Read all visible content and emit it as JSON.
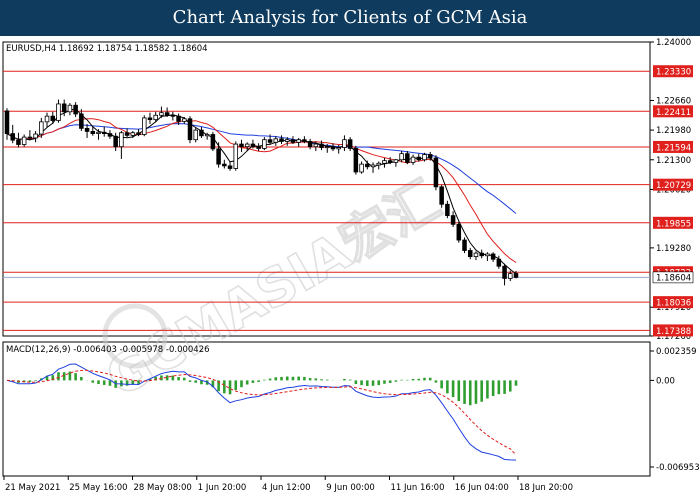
{
  "header": {
    "title": "Chart Analysis for Clients of GCM Asia"
  },
  "chart_data": {
    "type": "candlestick",
    "title": "EURUSD,H4 1.18692 1.18754 1.18582 1.18604",
    "symbol": "EURUSD",
    "timeframe": "H4",
    "ohlc_readout": {
      "open": 1.18692,
      "high": 1.18754,
      "low": 1.18582,
      "close": 1.18604
    },
    "current_price": 1.18604,
    "current_price_label": "1.18604",
    "price_axis": {
      "ylim": [
        1.1726,
        1.24
      ],
      "ticks": [
        {
          "value": 1.24,
          "label": "1.24000"
        },
        {
          "value": 1.2266,
          "label": "1.22660"
        },
        {
          "value": 1.2198,
          "label": "1.21980"
        },
        {
          "value": 1.213,
          "label": "1.21300"
        },
        {
          "value": 1.2062,
          "label": "1.20620"
        },
        {
          "value": 1.1928,
          "label": "1.19280"
        },
        {
          "value": 1.1792,
          "label": "1.17920"
        },
        {
          "value": 1.1726,
          "label": "1.17260"
        }
      ]
    },
    "levels": [
      {
        "value": 1.2333,
        "label": "1.23330"
      },
      {
        "value": 1.22411,
        "label": "1.22411"
      },
      {
        "value": 1.21594,
        "label": "1.21594"
      },
      {
        "value": 1.20729,
        "label": "1.20729"
      },
      {
        "value": 1.19855,
        "label": "1.19855"
      },
      {
        "value": 1.18722,
        "label": "1.18722"
      },
      {
        "value": 1.18036,
        "label": "1.18036"
      },
      {
        "value": 1.17388,
        "label": "1.17388"
      }
    ],
    "x_labels": [
      "21 May 2021",
      "25 May 16:00",
      "28 May 08:00",
      "1 Jun 20:00",
      "4 Jun 12:00",
      "9 Jun 00:00",
      "11 Jun 16:00",
      "16 Jun 04:00",
      "18 Jun 20:00"
    ],
    "candles": [
      [
        1.2242,
        1.2248,
        1.2176,
        1.219
      ],
      [
        1.219,
        1.221,
        1.2168,
        1.2175
      ],
      [
        1.2175,
        1.2192,
        1.2158,
        1.2165
      ],
      [
        1.2165,
        1.2188,
        1.216,
        1.2182
      ],
      [
        1.2182,
        1.2198,
        1.2175,
        1.218
      ],
      [
        1.218,
        1.2196,
        1.217,
        1.2189
      ],
      [
        1.2189,
        1.2226,
        1.218,
        1.2217
      ],
      [
        1.2217,
        1.2238,
        1.2205,
        1.223
      ],
      [
        1.223,
        1.224,
        1.2212,
        1.222
      ],
      [
        1.222,
        1.2268,
        1.2215,
        1.2258
      ],
      [
        1.2258,
        1.2268,
        1.223,
        1.224
      ],
      [
        1.224,
        1.226,
        1.2232,
        1.2255
      ],
      [
        1.2255,
        1.2262,
        1.2228,
        1.2235
      ],
      [
        1.2235,
        1.2246,
        1.2196,
        1.2202
      ],
      [
        1.2202,
        1.2212,
        1.218,
        1.2195
      ],
      [
        1.2195,
        1.2208,
        1.2185,
        1.219
      ],
      [
        1.219,
        1.22,
        1.2176,
        1.2193
      ],
      [
        1.2193,
        1.2206,
        1.2183,
        1.219
      ],
      [
        1.219,
        1.2198,
        1.2178,
        1.2184
      ],
      [
        1.2184,
        1.2192,
        1.215,
        1.216
      ],
      [
        1.216,
        1.2196,
        1.2132,
        1.2192
      ],
      [
        1.2192,
        1.2202,
        1.2182,
        1.2186
      ],
      [
        1.2186,
        1.2196,
        1.218,
        1.2192
      ],
      [
        1.2192,
        1.22,
        1.2184,
        1.2188
      ],
      [
        1.2188,
        1.2232,
        1.2184,
        1.2226
      ],
      [
        1.2226,
        1.2238,
        1.2212,
        1.2222
      ],
      [
        1.2222,
        1.224,
        1.2216,
        1.2232
      ],
      [
        1.2232,
        1.2252,
        1.2226,
        1.2238
      ],
      [
        1.2238,
        1.225,
        1.2228,
        1.2232
      ],
      [
        1.2232,
        1.224,
        1.222,
        1.223
      ],
      [
        1.223,
        1.2236,
        1.221,
        1.2218
      ],
      [
        1.2218,
        1.2228,
        1.2212,
        1.2224
      ],
      [
        1.2224,
        1.223,
        1.2168,
        1.2176
      ],
      [
        1.2176,
        1.2205,
        1.217,
        1.2198
      ],
      [
        1.2198,
        1.2205,
        1.218,
        1.2185
      ],
      [
        1.2185,
        1.2192,
        1.2176,
        1.2188
      ],
      [
        1.2188,
        1.2194,
        1.215,
        1.2155
      ],
      [
        1.2155,
        1.217,
        1.2112,
        1.212
      ],
      [
        1.212,
        1.213,
        1.211,
        1.2116
      ],
      [
        1.2116,
        1.2125,
        1.2105,
        1.211
      ],
      [
        1.211,
        1.2172,
        1.2105,
        1.2166
      ],
      [
        1.2166,
        1.2176,
        1.2148,
        1.216
      ],
      [
        1.216,
        1.217,
        1.215,
        1.2166
      ],
      [
        1.2166,
        1.2176,
        1.2156,
        1.216
      ],
      [
        1.216,
        1.2168,
        1.215,
        1.2156
      ],
      [
        1.2156,
        1.2182,
        1.2152,
        1.2176
      ],
      [
        1.2176,
        1.2188,
        1.2164,
        1.217
      ],
      [
        1.217,
        1.2184,
        1.2162,
        1.2178
      ],
      [
        1.2178,
        1.2186,
        1.2166,
        1.2172
      ],
      [
        1.2172,
        1.2182,
        1.2162,
        1.2176
      ],
      [
        1.2176,
        1.2184,
        1.2166,
        1.217
      ],
      [
        1.217,
        1.218,
        1.216,
        1.2176
      ],
      [
        1.2176,
        1.2184,
        1.2168,
        1.2172
      ],
      [
        1.2172,
        1.2178,
        1.2154,
        1.216
      ],
      [
        1.216,
        1.2172,
        1.215,
        1.2166
      ],
      [
        1.2166,
        1.2174,
        1.2152,
        1.2158
      ],
      [
        1.2158,
        1.2166,
        1.2146,
        1.216
      ],
      [
        1.216,
        1.2168,
        1.215,
        1.2155
      ],
      [
        1.2155,
        1.2164,
        1.2144,
        1.2158
      ],
      [
        1.2158,
        1.2186,
        1.215,
        1.2176
      ],
      [
        1.2176,
        1.2182,
        1.215,
        1.2156
      ],
      [
        1.2156,
        1.2162,
        1.2096,
        1.2102
      ],
      [
        1.2102,
        1.2126,
        1.2098,
        1.212
      ],
      [
        1.212,
        1.2128,
        1.2108,
        1.2114
      ],
      [
        1.2114,
        1.2124,
        1.21,
        1.2118
      ],
      [
        1.2118,
        1.2126,
        1.2108,
        1.2122
      ],
      [
        1.2122,
        1.2134,
        1.2112,
        1.2128
      ],
      [
        1.2128,
        1.2136,
        1.212,
        1.2124
      ],
      [
        1.2124,
        1.2132,
        1.2114,
        1.213
      ],
      [
        1.213,
        1.215,
        1.2124,
        1.2144
      ],
      [
        1.2144,
        1.215,
        1.212,
        1.2124
      ],
      [
        1.2124,
        1.2142,
        1.2118,
        1.2136
      ],
      [
        1.2136,
        1.2144,
        1.2126,
        1.213
      ],
      [
        1.213,
        1.2146,
        1.2126,
        1.2142
      ],
      [
        1.2142,
        1.2148,
        1.2128,
        1.2134
      ],
      [
        1.2134,
        1.214,
        1.206,
        1.2068
      ],
      [
        1.2068,
        1.2072,
        1.202,
        1.2028
      ],
      [
        1.2028,
        1.2036,
        1.1996,
        1.2002
      ],
      [
        1.2002,
        1.2012,
        1.1976,
        1.1982
      ],
      [
        1.1982,
        1.1988,
        1.194,
        1.1946
      ],
      [
        1.1946,
        1.1952,
        1.1916,
        1.1922
      ],
      [
        1.1922,
        1.1928,
        1.1902,
        1.1908
      ],
      [
        1.1908,
        1.192,
        1.19,
        1.1916
      ],
      [
        1.1916,
        1.1924,
        1.1904,
        1.191
      ],
      [
        1.191,
        1.1918,
        1.1898,
        1.1914
      ],
      [
        1.1914,
        1.1918,
        1.1896,
        1.1902
      ],
      [
        1.1902,
        1.191,
        1.188,
        1.1886
      ],
      [
        1.1886,
        1.1892,
        1.1842,
        1.1858
      ],
      [
        1.1858,
        1.1876,
        1.1852,
        1.1869
      ],
      [
        1.18692,
        1.18754,
        1.18582,
        1.18604
      ]
    ],
    "macd": {
      "label": "MACD(12,26,9) -0.006403 -0.005978 -0.000426",
      "params": [
        12,
        26,
        9
      ],
      "values": {
        "macd": -0.006403,
        "signal": -0.005978,
        "histogram": -0.000426
      },
      "ylim": [
        -0.006953,
        0.002359
      ],
      "ticks": [
        {
          "value": 0.002359,
          "label": "0.002359"
        },
        {
          "value": 0.0,
          "label": "0.00"
        },
        {
          "value": -0.006953,
          "label": "-0.006953"
        }
      ]
    },
    "colors": {
      "header_bg": "#0e3b5e",
      "level_line": "#e0201c",
      "level_tag": "#e0201c",
      "candle": "#000000",
      "ma_fast": "#000000",
      "ma_mid": "#e0201c",
      "ma_slow": "#1f3fe0",
      "macd_line": "#1f3fe0",
      "signal_line": "#e0201c",
      "histogram": "#2e9e2e",
      "price_line": "#9aa8c8"
    },
    "grid": false,
    "watermark": "GCMASIA宏汇"
  }
}
